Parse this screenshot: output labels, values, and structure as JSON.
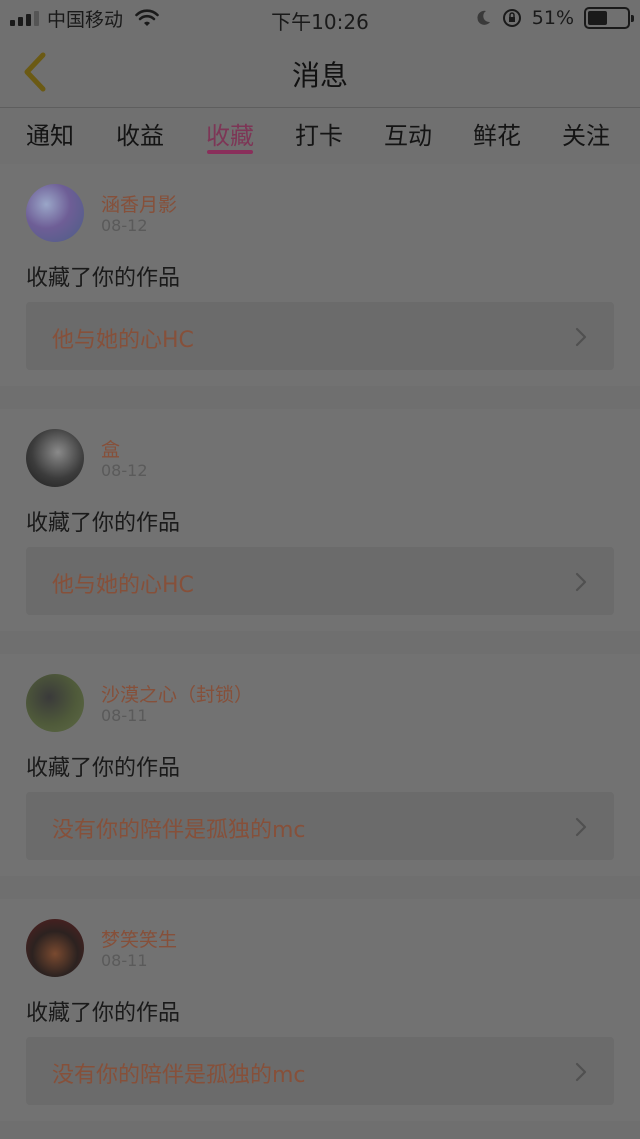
{
  "status_bar": {
    "carrier": "中国移动",
    "time": "下午10:26",
    "battery_percent_label": "51%",
    "battery_level": 0.51,
    "icons": [
      "signal-icon",
      "wifi-icon",
      "moon-icon",
      "rotation-lock-icon",
      "battery-icon"
    ]
  },
  "nav": {
    "title": "消息",
    "back_icon": "chevron-left-icon"
  },
  "tabs": [
    {
      "label": "通知"
    },
    {
      "label": "收益"
    },
    {
      "label": "收藏",
      "active": true
    },
    {
      "label": "打卡"
    },
    {
      "label": "互动"
    },
    {
      "label": "鲜花"
    },
    {
      "label": "关注"
    }
  ],
  "messages": [
    {
      "user": "涵香月影",
      "date": "08-12",
      "action": "收藏了你的作品",
      "work_title": "他与她的心HC"
    },
    {
      "user": "盒",
      "date": "08-12",
      "action": "收藏了你的作品",
      "work_title": "他与她的心HC"
    },
    {
      "user": "沙漠之心（封锁）",
      "date": "08-11",
      "action": "收藏了你的作品",
      "work_title": "没有你的陪伴是孤独的mc"
    },
    {
      "user": "梦笑笑生",
      "date": "08-11",
      "action": "收藏了你的作品",
      "work_title": "没有你的陪伴是孤独的mc"
    }
  ],
  "colors": {
    "accent": "#8a2f5b",
    "name_color": "#86503a",
    "overlay_background": "#6f6f6f"
  }
}
